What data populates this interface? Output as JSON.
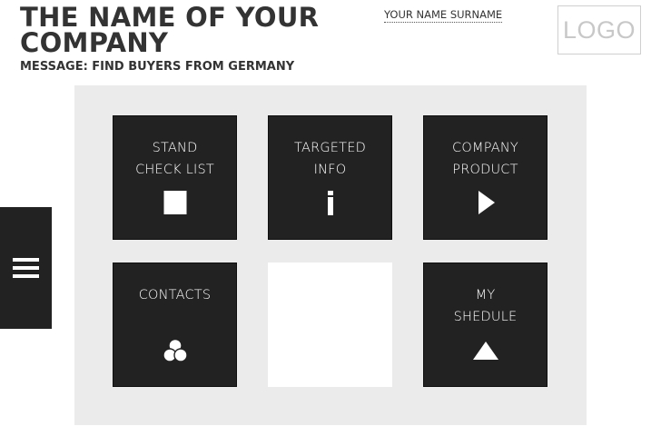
{
  "header": {
    "company_name": "THE NAME OF YOUR COMPANY",
    "message": "MESSAGE: FIND BUYERS FROM GERMANY",
    "user_name": "YOUR NAME SURNAME",
    "logo_text": "LOGO"
  },
  "menu": {
    "icon": "hamburger-icon"
  },
  "tiles": [
    {
      "line1": "STAND",
      "line2": "CHECK LIST",
      "icon": "square-icon"
    },
    {
      "line1": "TARGETED",
      "line2": "INFO",
      "icon": "info-icon"
    },
    {
      "line1": "COMPANY",
      "line2": "PRODUCT",
      "icon": "play-icon"
    },
    {
      "line1": "CONTACTS",
      "line2": "",
      "icon": "circles-icon"
    },
    {
      "line1": "",
      "line2": "",
      "icon": ""
    },
    {
      "line1": "MY",
      "line2": "SHEDULE",
      "icon": "triangle-up-icon"
    }
  ],
  "colors": {
    "tile_background": "#222222",
    "panel_background": "#ebebeb",
    "text_dark": "#333333",
    "accent_white": "#ffffff"
  }
}
